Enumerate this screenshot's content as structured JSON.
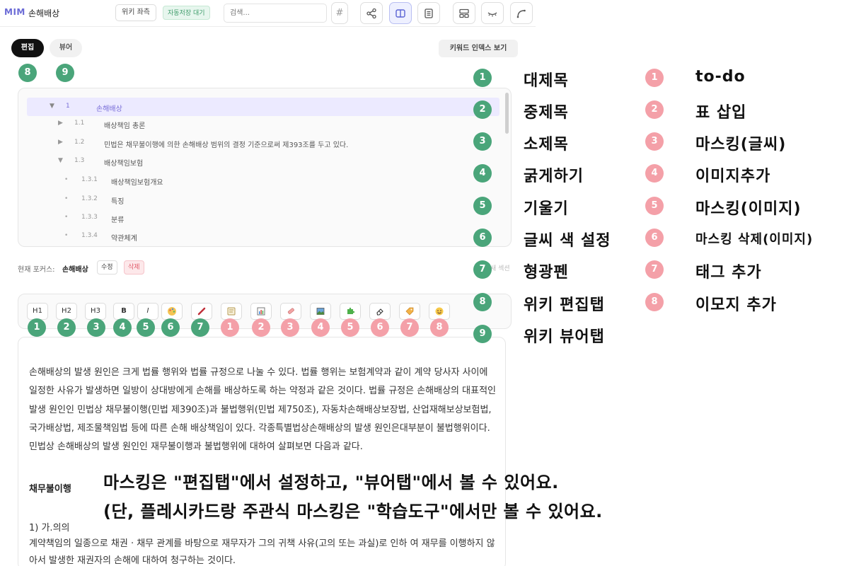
{
  "topbar": {
    "logo": "MIM",
    "title": "손해배상",
    "wiki_btn": "위키 좌측",
    "autosave": "자동저장 대기",
    "search_placeholder": "검색...",
    "hash": "#"
  },
  "tabs": {
    "edit": "편집",
    "view": "뷰어"
  },
  "keyword_btn": "키워드 인덱스 보기",
  "tree": [
    {
      "num": "1",
      "label": "손해배상",
      "arrow": "▼"
    },
    {
      "num": "1.1",
      "label": "배상책임 총론",
      "arrow": "▶"
    },
    {
      "num": "1.2",
      "label": "민법은 채무불이행에 의한 손해배상 범위의 결정 기준으로써 제393조를 두고 있다.",
      "arrow": "▶"
    },
    {
      "num": "1.3",
      "label": "배상책임보험",
      "arrow": "▼"
    },
    {
      "num": "1.3.1",
      "label": "배상책임보험개요",
      "arrow": "•"
    },
    {
      "num": "1.3.2",
      "label": "특징",
      "arrow": "•"
    },
    {
      "num": "1.3.3",
      "label": "분류",
      "arrow": "•"
    },
    {
      "num": "1.3.4",
      "label": "약관체계",
      "arrow": "•"
    }
  ],
  "focus": {
    "label": "현재 포커스:",
    "name": "손해배상",
    "edit": "수정",
    "delete": "삭제",
    "section": "새 섹션"
  },
  "format_buttons": {
    "h1": "H1",
    "h2": "H2",
    "h3": "H3",
    "bold": "B",
    "italic": "I"
  },
  "editor": {
    "paragraph": "손해배상의 발생 원인은 크게 법률 행위와 법률 규정으로 나눌 수 있다. 법률 행위는 보험계약과 같이 계약 당사자 사이에 일정한 사유가 발생하면 일방이 상대방에게 손해를 배상하도록 하는 약정과 같은 것이다. 법률 규정은 손해배상의 대표적인 발생 원인인 민법상 채무불이행(민법 제390조)과 불법행위(민법 제750조), 자동차손해배상보장법, 산업재해보상보험법, 국가배상법, 제조물책임법 등에 따른 손해 배상책임이 있다. 각종특별법상손해배상의 발생 원인은대부분이 불법행위이다. 민법상 손해배상의 발생 원인인 재무불이행과 불법행위에 대하여 살펴보면 다음과 같다.",
    "heading": "채무불이행",
    "sub_heading": "1) 가.의의",
    "sub_text": "계약책임의 일종으로 채권 · 채무 관계를 바탕으로 재무자가 그의 귀책 사유(고의 또는 과실)로 인하 여 재무를 이행하지 않아서 발생한 재권자의 손해에 대하여 청구하는 것이다."
  },
  "legend_green": [
    "대제목",
    "중제목",
    "소제목",
    "굵게하기",
    "기울기",
    "글씨 색 설정",
    "형광펜",
    "위키 편집탭",
    "위키 뷰어탭"
  ],
  "legend_pink": [
    "to-do",
    "표 삽입",
    "마스킹(글씨)",
    "이미지추가",
    "마스킹(이미지)",
    "마스킹 삭제(이미지)",
    "태그 추가",
    "이모지 추가"
  ],
  "badge_nums_green": [
    "1",
    "2",
    "3",
    "4",
    "5",
    "6",
    "7",
    "8",
    "9"
  ],
  "badge_nums_pink": [
    "1",
    "2",
    "3",
    "4",
    "5",
    "6",
    "7",
    "8"
  ],
  "notice": {
    "line1": "마스킹은 \"편집탭\"에서 설정하고, \"뷰어탭\"에서 볼 수 있어요.",
    "line2": "(단, 플레시카드랑 주관식 마스킹은 \"학습도구\"에서만 볼 수 있어요."
  },
  "colors": {
    "green": "#4aa57a",
    "pink": "#f4a0a8",
    "accent": "#6b6bd6"
  }
}
